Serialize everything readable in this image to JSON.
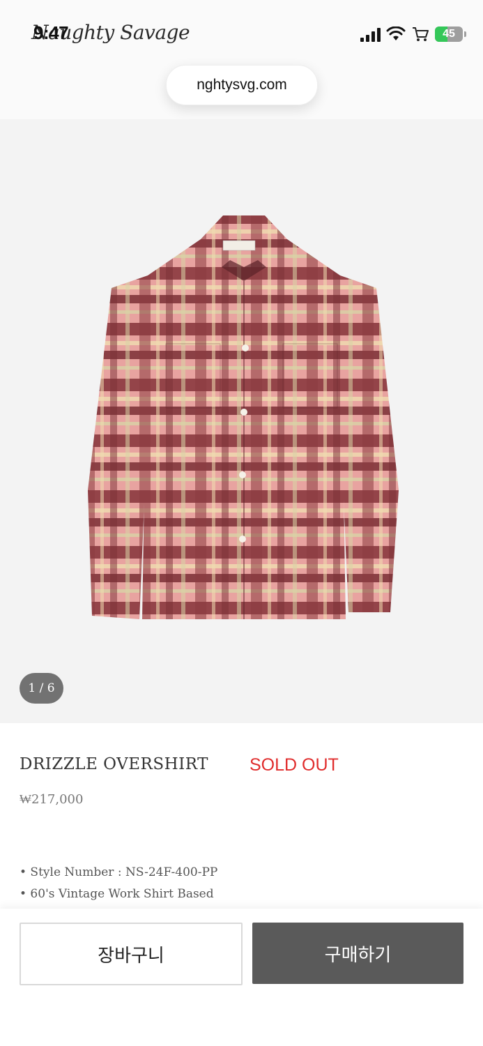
{
  "status": {
    "time": "9:47",
    "battery": "45",
    "battery_level": 0.45
  },
  "brand": {
    "name": "Naughty Savage"
  },
  "browser": {
    "url": "nghtysvg.com"
  },
  "gallery": {
    "counter": "1 / 6"
  },
  "product": {
    "title": "DRIZZLE OVERSHIRT",
    "status": "SOLD OUT",
    "price": "₩217,000",
    "details": [
      "• Style Number : NS-24F-400-PP",
      "• 60's Vintage Work Shirt Based"
    ]
  },
  "actions": {
    "cart_label": "장바구니",
    "buy_label": "구매하기"
  },
  "colors": {
    "accent_sold_out": "#e02c2c",
    "buy_button": "#5a5a5a",
    "gallery_bg": "#f3f3f3"
  },
  "icons": [
    "signal-icon",
    "wifi-icon",
    "cart-icon",
    "battery-icon"
  ]
}
